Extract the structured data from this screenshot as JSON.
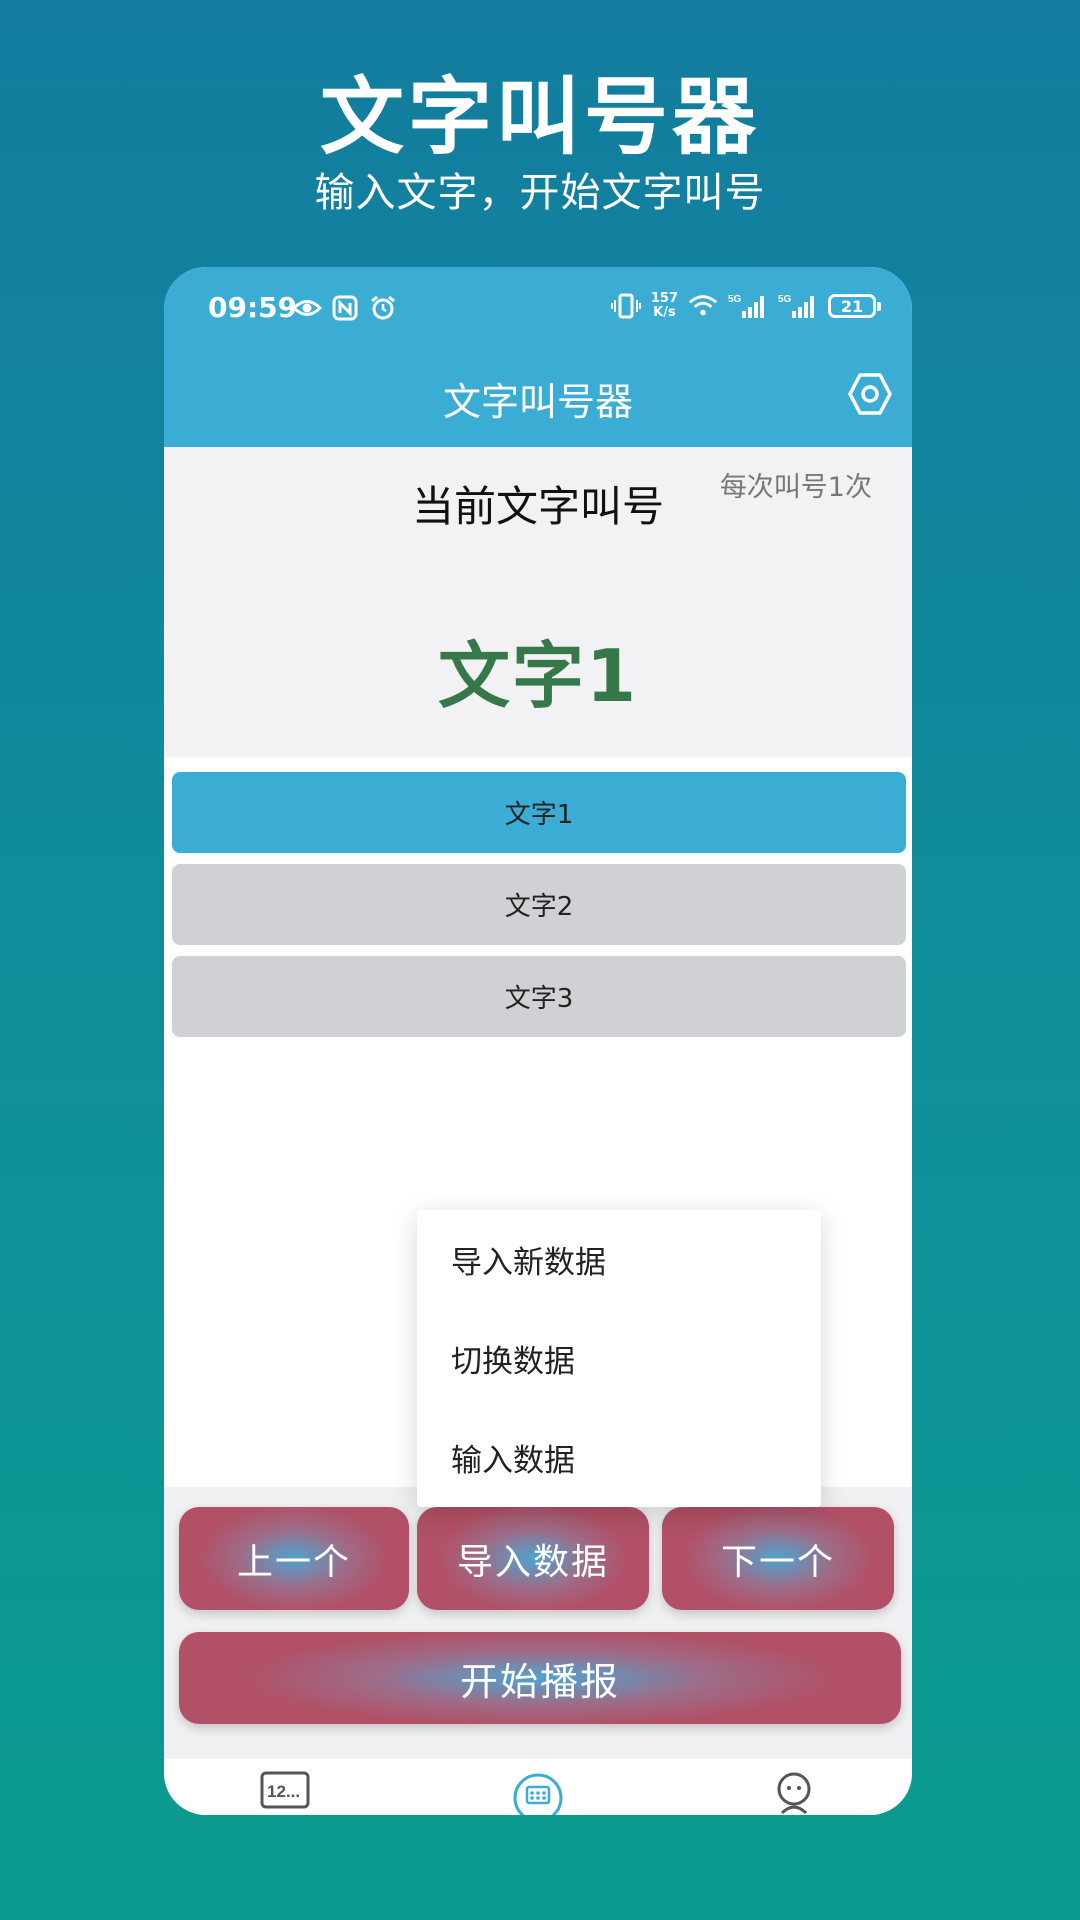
{
  "promo": {
    "title": "文字叫号器",
    "subtitle": "输入文字，开始文字叫号"
  },
  "status_bar": {
    "time": "09:59",
    "net_speed_value": "157",
    "net_speed_unit": "K/s",
    "network_1": "5G",
    "network_2": "5G",
    "battery": "21",
    "icons": [
      "eye-icon",
      "nfc-icon",
      "alarm-icon",
      "vibrate-icon",
      "wifi-icon",
      "signal-icon"
    ]
  },
  "app_bar": {
    "title": "文字叫号器",
    "settings_icon": "settings-icon"
  },
  "current": {
    "label": "当前文字叫号",
    "repeat_info": "每次叫号1次",
    "value": "文字1"
  },
  "list": {
    "items": [
      {
        "label": "文字1",
        "selected": true
      },
      {
        "label": "文字2",
        "selected": false
      },
      {
        "label": "文字3",
        "selected": false
      }
    ]
  },
  "popup_menu": {
    "items": [
      "导入新数据",
      "切换数据",
      "输入数据"
    ]
  },
  "actions": {
    "prev": "上一个",
    "import": "导入数据",
    "next": "下一个",
    "start": "开始播报"
  },
  "bottom_nav": {
    "items": [
      "numbers-icon",
      "keypad-icon",
      "profile-icon"
    ]
  },
  "colors": {
    "app_bar": "#3badd4",
    "selected_item": "#3badd4",
    "unselected_item": "#cfd1d5",
    "current_value": "#37784a",
    "action_button": "#b15066"
  }
}
